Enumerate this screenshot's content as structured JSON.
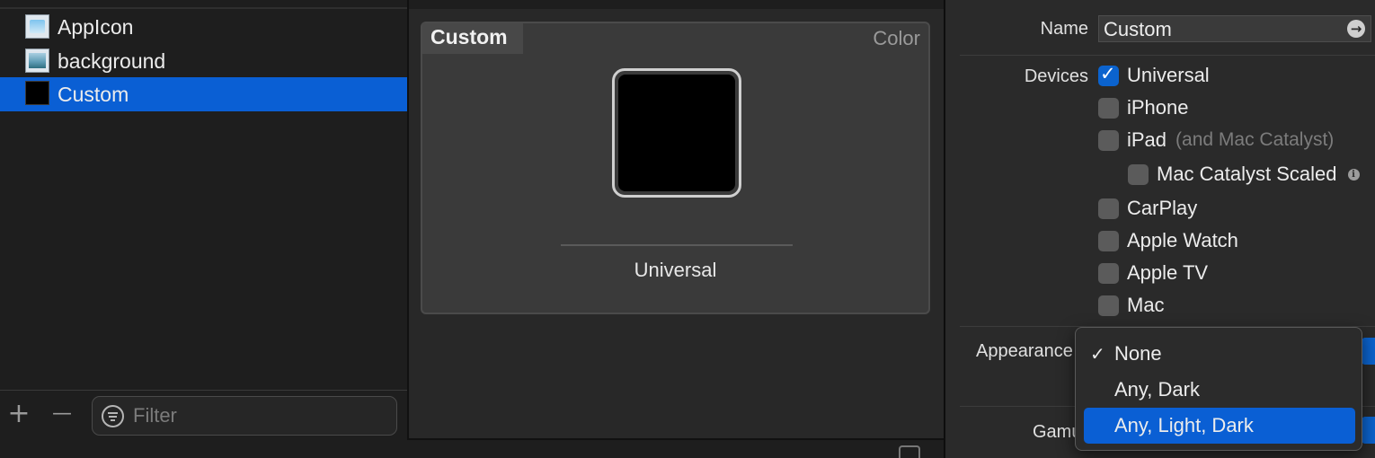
{
  "asset_list": {
    "items": [
      {
        "label": "AppIcon",
        "icon": "appicon-thumbnail",
        "selected": false
      },
      {
        "label": "background",
        "icon": "image-thumbnail",
        "selected": false
      },
      {
        "label": "Custom",
        "icon": "color-thumbnail",
        "selected": true
      }
    ],
    "footer": {
      "add_glyph": "+",
      "remove_glyph": "—",
      "filter_placeholder": "Filter",
      "filter_icon": "filter-icon"
    }
  },
  "editor": {
    "set_name": "Custom",
    "set_type": "Color",
    "swatch_color": "#000000",
    "swatch_caption": "Universal"
  },
  "inspector": {
    "name_label": "Name",
    "name_value": "Custom",
    "devices_label": "Devices",
    "devices": [
      {
        "label": "Universal",
        "checked": true
      },
      {
        "label": "iPhone",
        "checked": false
      },
      {
        "label": "iPad",
        "note": "(and Mac Catalyst)",
        "checked": false
      },
      {
        "label": "Mac Catalyst Scaled",
        "checked": false,
        "info_icon": "info-icon"
      },
      {
        "label": "CarPlay",
        "checked": false
      },
      {
        "label": "Apple Watch",
        "checked": false
      },
      {
        "label": "Apple TV",
        "checked": false
      },
      {
        "label": "Mac",
        "checked": false
      }
    ],
    "appearance_label": "Appearance",
    "gamut_label": "Gamu"
  },
  "appearance_menu": {
    "check_glyph": "✓",
    "options": [
      {
        "label": "None",
        "checked": true,
        "highlighted": false
      },
      {
        "label": "Any, Dark",
        "checked": false,
        "highlighted": false
      },
      {
        "label": "Any, Light, Dark",
        "checked": false,
        "highlighted": true
      }
    ]
  },
  "colors": {
    "selection": "#0a5fd4",
    "checkbox_on": "#0b63ce"
  }
}
